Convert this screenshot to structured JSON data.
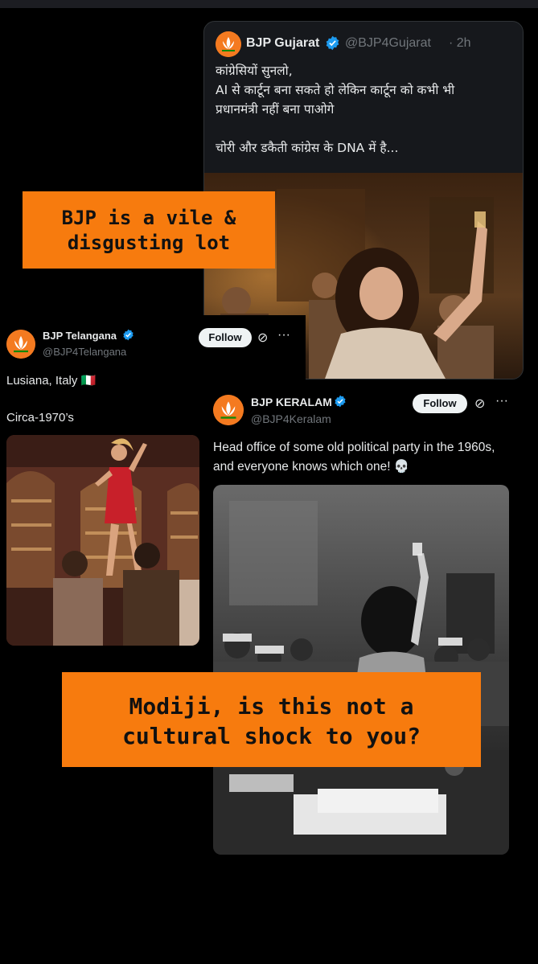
{
  "gujarat": {
    "name": "BJP Gujarat",
    "handle": "@BJP4Gujarat",
    "time": "· 2h",
    "text_lines": [
      "कांग्रेसियों सुनलो,",
      "AI से कार्टून बना सकते हो लेकिन कार्टून को कभी भी",
      "प्रधानमंत्री नहीं बना पाओगे",
      "",
      "चोरी और डकैती कांग्रेस के DNA में है..."
    ]
  },
  "telangana": {
    "name": "BJP Telangana",
    "handle": "@BJP4Telangana",
    "follow_label": "Follow",
    "line1": "Lusiana, Italy 🇮🇹",
    "line2": "Circa-1970’s"
  },
  "keralam": {
    "name": "BJP KERALAM",
    "handle": "@BJP4Keralam",
    "follow_label": "Follow",
    "text": "Head office of some old political party in the 1960s, and everyone knows which one! 💀"
  },
  "banners": {
    "top_line1": "BJP is a vile &",
    "top_line2": "disgusting lot",
    "bottom_line1": "Modiji, is this not a",
    "bottom_line2": "cultural shock to you?"
  },
  "colors": {
    "background": "#000000",
    "card": "#16181c",
    "banner": "#f77b0e",
    "verified": "#1d9bf0",
    "avatar": "#f47a20"
  },
  "icons": [
    "verified-badge-icon",
    "grok-icon",
    "more-icon",
    "lotus-icon"
  ]
}
